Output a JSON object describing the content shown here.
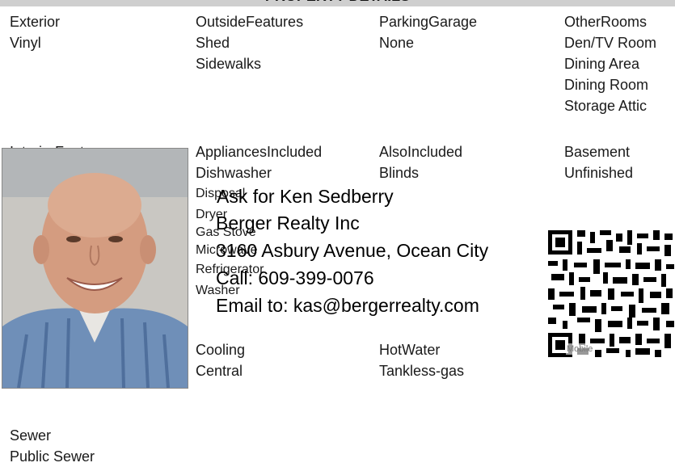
{
  "header": {
    "title": "PROPERTY DETAILS"
  },
  "fields": {
    "exterior": {
      "label": "Exterior",
      "values": [
        "Vinyl"
      ]
    },
    "outside": {
      "label": "OutsideFeatures",
      "values": [
        "Shed",
        "Sidewalks"
      ]
    },
    "parking": {
      "label": "ParkingGarage",
      "values": [
        "None"
      ]
    },
    "other_rooms": {
      "label": "OtherRooms",
      "values": [
        "Den/TV Room",
        "Dining Area",
        "Dining Room",
        "Storage Attic"
      ]
    },
    "interior": {
      "label": "InteriorFeatures"
    },
    "appliances": {
      "label": "AppliancesIncluded",
      "values": [
        "Dishwasher",
        "Disposal",
        "Dryer",
        "Gas Stove",
        "Microwave",
        "Refrigerator",
        "Washer"
      ]
    },
    "also": {
      "label": "AlsoIncluded",
      "values": [
        "Blinds"
      ]
    },
    "basement": {
      "label": "Basement",
      "values": [
        "Unfinished"
      ]
    },
    "cooling": {
      "label": "Cooling",
      "values": [
        "Central"
      ]
    },
    "hotwater": {
      "label": "HotWater",
      "values": [
        "Tankless-gas"
      ]
    },
    "sewer": {
      "label": "Sewer",
      "values": [
        "Public Sewer"
      ]
    }
  },
  "agent": {
    "ask_line": "Ask for Ken Sedberry",
    "company": "Berger Realty Inc",
    "address": "3160 Asbury Avenue, Ocean City",
    "phone": "Call: 609-399-0076",
    "email": "Email to: kas@bergerrealty.com"
  },
  "qr_caption": "Mobile"
}
